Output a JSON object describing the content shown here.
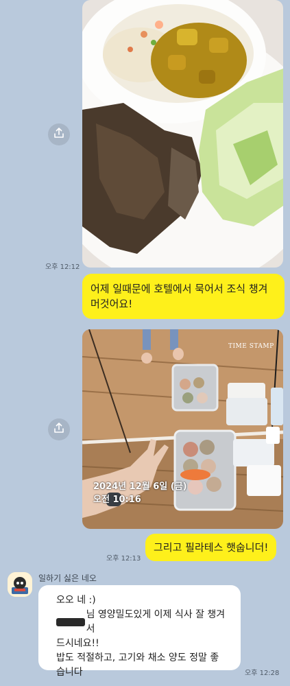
{
  "messages": [
    {
      "type": "photo",
      "time": "오후 12:12"
    },
    {
      "type": "text",
      "text": "어제 일때문에 호텔에서 묵어서 조식 챙겨 머것어요!"
    },
    {
      "type": "photo",
      "time": "",
      "stamp_label": "TIME STAMP",
      "stamp_date": "2024년 12월 6일 (금)",
      "stamp_time": "오전 10:16"
    },
    {
      "type": "text",
      "text": "그리고 필라테스 햇숩니더!",
      "time": "오후 12:13"
    }
  ],
  "incoming": {
    "sender": "일하기 싫은 네오",
    "text_line1": "오오 네 :)",
    "text_line2": "님 영양밀도있게 이제 식사 잘 챙겨서",
    "text_line3": "드시네요!!",
    "text_line4": "밥도 적절하고, 고기와 채소 양도 정말 좋",
    "text_line5": "습니다",
    "time": "오후 12:28"
  },
  "colors": {
    "background": "#b9c9dc",
    "my_bubble": "#fef01b",
    "other_bubble": "#ffffff"
  },
  "icons": {
    "share": "share-icon",
    "avatar": "neo-avatar-icon"
  }
}
